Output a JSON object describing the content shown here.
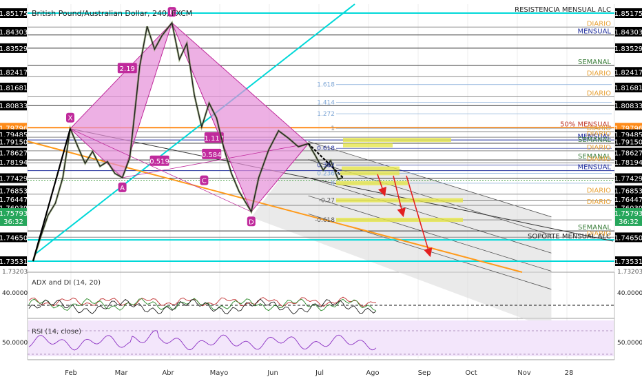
{
  "header": {
    "title": "British Pound/Australian Dollar, 240, FXCM"
  },
  "left_axis": {
    "labels": [
      {
        "text": "1.85175",
        "price": 1.85175,
        "bg": "#000000"
      },
      {
        "text": "1.84303",
        "price": 1.84303,
        "bg": "#000000"
      },
      {
        "text": "1.83529",
        "price": 1.83529,
        "bg": "#000000"
      },
      {
        "text": "1.82417",
        "price": 1.82417,
        "bg": "#000000"
      },
      {
        "text": "1.81681",
        "price": 1.81681,
        "bg": "#000000"
      },
      {
        "text": "1.80833",
        "price": 1.80833,
        "bg": "#000000"
      },
      {
        "text": "1.79796",
        "price": 1.79796,
        "bg": "#ff8c1a"
      },
      {
        "text": "1.79485",
        "price": 1.79485,
        "bg": "#000000"
      },
      {
        "text": "1.79150",
        "price": 1.7915,
        "bg": "#000000"
      },
      {
        "text": "1.78627",
        "price": 1.78627,
        "bg": "#000000"
      },
      {
        "text": "1.78194",
        "price": 1.78194,
        "bg": "#000000"
      },
      {
        "text": "1.77429",
        "price": 1.77429,
        "bg": "#000000"
      },
      {
        "text": "1.76853",
        "price": 1.76853,
        "bg": "#000000"
      },
      {
        "text": "1.76447",
        "price": 1.76447,
        "bg": "#000000"
      },
      {
        "text": "1.76039",
        "price": 1.76039,
        "bg": "#000000"
      },
      {
        "text": "1.75793",
        "price": 1.75793,
        "bg": "#26a65b"
      },
      {
        "text": "36:32",
        "price": 1.7541,
        "bg": "#26a65b"
      },
      {
        "text": "1.74650",
        "price": 1.7465,
        "bg": "#000000"
      },
      {
        "text": "1.73531",
        "price": 1.73531,
        "bg": "#000000"
      }
    ],
    "partial_label": "1.73203"
  },
  "right_axis": {
    "labels": [
      {
        "text": "1.85175",
        "price": 1.85175,
        "bg": "#000000"
      },
      {
        "text": "1.84303",
        "price": 1.84303,
        "bg": "#000000"
      },
      {
        "text": "1.83529",
        "price": 1.83529,
        "bg": "#000000"
      },
      {
        "text": "1.82417",
        "price": 1.82417,
        "bg": "#000000"
      },
      {
        "text": "1.81681",
        "price": 1.81681,
        "bg": "#000000"
      },
      {
        "text": "1.80833",
        "price": 1.80833,
        "bg": "#000000"
      },
      {
        "text": "1.79796",
        "price": 1.79796,
        "bg": "#ff8c1a"
      },
      {
        "text": "1.79485",
        "price": 1.79485,
        "bg": "#000000"
      },
      {
        "text": "1.79150",
        "price": 1.7915,
        "bg": "#000000"
      },
      {
        "text": "1.78627",
        "price": 1.78627,
        "bg": "#000000"
      },
      {
        "text": "1.78194",
        "price": 1.78194,
        "bg": "#000000"
      },
      {
        "text": "1.77429",
        "price": 1.77429,
        "bg": "#000000"
      },
      {
        "text": "1.76853",
        "price": 1.76853,
        "bg": "#000000"
      },
      {
        "text": "1.76447",
        "price": 1.76447,
        "bg": "#000000"
      },
      {
        "text": "1.76039",
        "price": 1.76039,
        "bg": "#000000"
      },
      {
        "text": "1.75793",
        "price": 1.75793,
        "bg": "#26a65b"
      },
      {
        "text": "36:32",
        "price": 1.7541,
        "bg": "#26a65b"
      },
      {
        "text": "1.74650",
        "price": 1.7465,
        "bg": "#000000"
      },
      {
        "text": "1.73531",
        "price": 1.73531,
        "bg": "#000000"
      }
    ],
    "partial_label": "1.73203"
  },
  "levels": [
    {
      "label": "RESISTENCIA MENSUAL ALC",
      "price": 1.85175,
      "line_color": "#00d8d8",
      "text_color": "#222222"
    },
    {
      "label": "DIARIO",
      "price": 1.8452,
      "line_color": "#888888",
      "text_color": "#e8a33a"
    },
    {
      "label": "MENSUAL",
      "price": 1.8415,
      "line_color": "#333333",
      "text_color": "#1f2d9c"
    },
    {
      "label": "",
      "price": 1.83529,
      "line_color": "#333333",
      "text_color": "#000000"
    },
    {
      "label": "SEMANAL",
      "price": 1.8272,
      "line_color": "#333333",
      "text_color": "#3a7d3a"
    },
    {
      "label": "DIARIO",
      "price": 1.8219,
      "line_color": "#888888",
      "text_color": "#e8a33a"
    },
    {
      "label": "DIARIO",
      "price": 1.8125,
      "line_color": "#888888",
      "text_color": "#e8a33a"
    },
    {
      "label": "",
      "price": 1.80833,
      "line_color": "#333333",
      "text_color": "#000000"
    },
    {
      "label": "50% MENSUAL",
      "price": 1.79796,
      "line_color": "#ff8c1a",
      "text_color": "#c0392b"
    },
    {
      "label": "DIARIO",
      "price": 1.7961,
      "line_color": "#888888",
      "text_color": "#e8a33a"
    },
    {
      "label": "DIARIO",
      "price": 1.7935,
      "line_color": "#888888",
      "text_color": "#e8a33a"
    },
    {
      "label": "MENSUAL",
      "price": 1.7922,
      "line_color": "#1f2d9c",
      "text_color": "#1f2d9c"
    },
    {
      "label": "SEMANAL",
      "price": 1.79066,
      "line_color": "#333333",
      "text_color": "#3a7d3a"
    },
    {
      "label": "DIARIO",
      "price": 1.7871,
      "line_color": "#888888",
      "text_color": "#e8a33a"
    },
    {
      "label": "SEMANAL",
      "price": 1.7828,
      "line_color": "#333333",
      "text_color": "#3a7d3a"
    },
    {
      "label": "DIARIO",
      "price": 1.7815,
      "line_color": "#888888",
      "text_color": "#e8a33a"
    },
    {
      "label": "MENSUAL",
      "price": 1.7778,
      "line_color": "#1f2d9c",
      "text_color": "#1f2d9c"
    },
    {
      "label": "",
      "price": 1.77429,
      "line_color": "#333333",
      "text_color": "#000000"
    },
    {
      "label": "DIARIO",
      "price": 1.76678,
      "line_color": "#888888",
      "text_color": "#e8a33a"
    },
    {
      "label": "DIARIO",
      "price": 1.7615,
      "line_color": "#888888",
      "text_color": "#e8a33a"
    },
    {
      "label": "SEMANAL",
      "price": 1.7495,
      "line_color": "#333333",
      "text_color": "#3a7d3a"
    },
    {
      "label": "DIARIO",
      "price": 1.74655,
      "line_color": "#888888",
      "text_color": "#e8a33a"
    },
    {
      "label": "SOPORTE MENSUAL ALC",
      "price": 1.7453,
      "line_color": "#00d8d8",
      "text_color": "#222222"
    },
    {
      "label": "",
      "price": 1.73531,
      "line_color": "#00d8d8",
      "text_color": "#000000"
    }
  ],
  "fib_labels": [
    {
      "text": "1.618",
      "price": 1.8182,
      "color": "#7fa7d6"
    },
    {
      "text": "1.414",
      "price": 1.8098,
      "color": "#7fa7d6"
    },
    {
      "text": "1.272",
      "price": 1.8045,
      "color": "#7fa7d6"
    },
    {
      "text": "1",
      "price": 1.7977,
      "color": "#888888"
    },
    {
      "text": "0.618",
      "price": 1.7883,
      "color": "#1f2d9c"
    },
    {
      "text": "0.382",
      "price": 1.7804,
      "color": "#1f2d9c"
    },
    {
      "text": "0.236",
      "price": 1.7766,
      "color": "#7fa7d6"
    },
    {
      "text": "0",
      "price": 1.7719,
      "color": "#7fa7d6"
    },
    {
      "text": "-0.27",
      "price": 1.7639,
      "color": "#555555"
    },
    {
      "text": "-0.618",
      "price": 1.7547,
      "color": "#555555"
    }
  ],
  "pattern": {
    "points": [
      {
        "name": "X",
        "time": 1.3,
        "price": 1.7975
      },
      {
        "name": "A",
        "time": 2.35,
        "price": 1.7745
      },
      {
        "name": "B",
        "time": 3.35,
        "price": 1.8472
      },
      {
        "name": "C",
        "time": 4.0,
        "price": 1.7778
      },
      {
        "name": "D",
        "time": 4.95,
        "price": 1.7585
      },
      {
        "name": "",
        "time": 6.1,
        "price": 1.7905
      }
    ],
    "ratios": [
      {
        "text": "2.19",
        "time": 2.45,
        "price": 1.8258
      },
      {
        "text": "0.519",
        "time": 3.1,
        "price": 1.7823
      },
      {
        "text": "1.117",
        "time": 4.2,
        "price": 1.7932
      },
      {
        "text": "0.584",
        "time": 4.15,
        "price": 1.7855
      }
    ]
  },
  "price_series": [
    [
      0.55,
      1.7353
    ],
    [
      0.7,
      1.7465
    ],
    [
      0.85,
      1.7568
    ],
    [
      1.0,
      1.7625
    ],
    [
      1.15,
      1.7745
    ],
    [
      1.3,
      1.7975
    ],
    [
      1.45,
      1.7892
    ],
    [
      1.6,
      1.7812
    ],
    [
      1.75,
      1.7868
    ],
    [
      1.9,
      1.7798
    ],
    [
      2.05,
      1.782
    ],
    [
      2.2,
      1.7765
    ],
    [
      2.35,
      1.7745
    ],
    [
      2.5,
      1.7838
    ],
    [
      2.6,
      1.805
    ],
    [
      2.7,
      1.8268
    ],
    [
      2.85,
      1.8455
    ],
    [
      3.0,
      1.8348
    ],
    [
      3.15,
      1.8412
    ],
    [
      3.35,
      1.8472
    ],
    [
      3.5,
      1.83
    ],
    [
      3.65,
      1.8375
    ],
    [
      3.8,
      1.8135
    ],
    [
      3.95,
      1.7983
    ],
    [
      4.1,
      1.8095
    ],
    [
      4.25,
      1.8025
    ],
    [
      4.4,
      1.788
    ],
    [
      4.55,
      1.7765
    ],
    [
      4.7,
      1.7682
    ],
    [
      4.95,
      1.7585
    ],
    [
      5.1,
      1.7745
    ],
    [
      5.3,
      1.7875
    ],
    [
      5.5,
      1.7965
    ],
    [
      5.7,
      1.793
    ],
    [
      5.9,
      1.789
    ],
    [
      6.1,
      1.7905
    ],
    [
      6.25,
      1.7845
    ],
    [
      6.4,
      1.778
    ],
    [
      6.55,
      1.7825
    ],
    [
      6.7,
      1.7738
    ],
    [
      6.8,
      1.7745
    ]
  ],
  "month_labels": [
    "Feb",
    "Mar",
    "Abr",
    "Mayo",
    "Jun",
    "Jul",
    "Ago",
    "Sep",
    "Oct",
    "Nov",
    "28"
  ],
  "indicators": {
    "adx": {
      "title": "ADX and DI (14, 20)",
      "level_label": "40.0000",
      "right_label": "40.0000"
    },
    "rsi": {
      "title": "RSI (14, close)",
      "level_label": "50.0000",
      "right_label": "50.0000"
    }
  },
  "colors": {
    "accent_cyan": "#00d8d8",
    "pattern_fill": "#e58fd8",
    "pattern_stroke": "#c02a9c",
    "channel_fill": "#d8d8d8",
    "highlight_yellow": "#e6e64a",
    "arrow_red": "#e32020",
    "support_orange": "#ff9a1a",
    "rsi_purple": "#8a2fc2"
  }
}
